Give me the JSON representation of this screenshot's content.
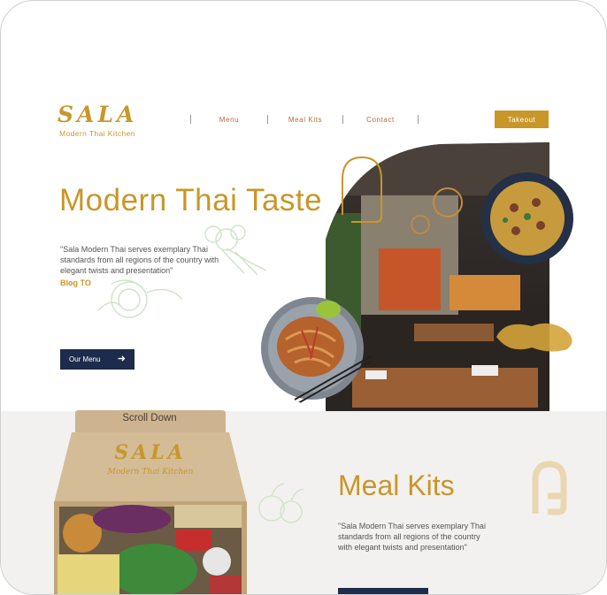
{
  "brand": {
    "logo_text": "SALA",
    "tagline": "Modern Thai Kitchen"
  },
  "nav": {
    "items": [
      "Menu",
      "Meal Kits",
      "Contact"
    ],
    "takeout_label": "Takeout"
  },
  "hero": {
    "title": "Modern Thai Taste",
    "quote": "\"Sala Modern Thai serves exemplary Thai standards from all regions of the country with elegant twists and presentation\"",
    "source": "Blog TO",
    "cta_label": "Our Menu",
    "cta_icon": "arrow-right-icon"
  },
  "scroll_hint": "Scroll Down",
  "box": {
    "logo_text": "SALA",
    "tagline": "Modern Thai Kitchen"
  },
  "meal_kits": {
    "title": "Meal Kits",
    "quote": "\"Sala Modern Thai serves exemplary Thai standards from all regions of the country with elegant twists and presentation\""
  },
  "colors": {
    "gold": "#c9962a",
    "navy": "#1d2b4c",
    "nav_text": "#b66a3a",
    "section_bg": "#f3f1ef"
  }
}
